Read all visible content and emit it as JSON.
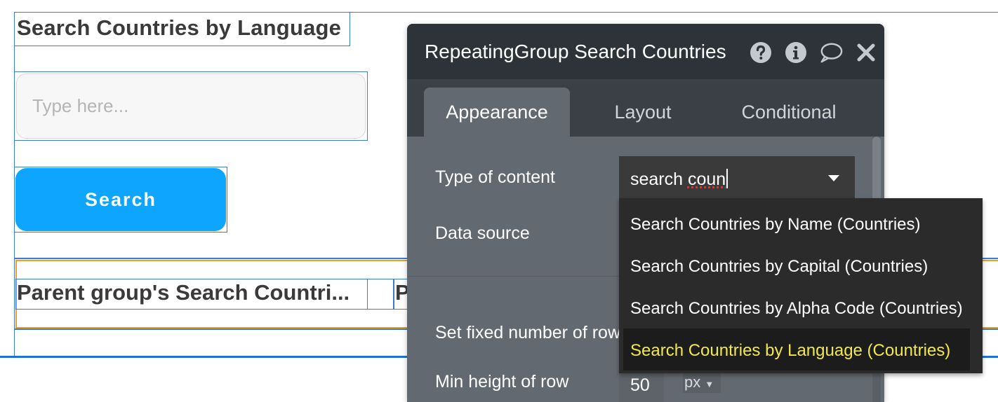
{
  "canvas": {
    "page_title": "Search Countries by Language",
    "input_placeholder": "Type here...",
    "search_button": "Search",
    "repeating_group": {
      "cell1_text": "Parent group's Search Countri...",
      "cell3_text": "P"
    }
  },
  "panel": {
    "title": "RepeatingGroup Search Countries",
    "icons": [
      "help-icon",
      "info-icon",
      "comment-icon",
      "close-icon"
    ],
    "tabs": [
      {
        "label": "Appearance",
        "active": true
      },
      {
        "label": "Layout",
        "active": false
      },
      {
        "label": "Conditional",
        "active": false
      }
    ],
    "properties": {
      "type_of_content_label": "Type of content",
      "type_of_content_value_prefix": "search ",
      "type_of_content_value_misspelled": "coun",
      "data_source_label": "Data source",
      "fixed_rows_label": "Set fixed number of rows",
      "min_height_label": "Min height of row",
      "min_height_value": "50",
      "min_height_unit": "px"
    }
  },
  "dropdown": {
    "items": [
      "Search Countries by Name (Countries)",
      "Search Countries by Capital (Countries)",
      "Search Countries by Alpha Code (Countries)",
      "Search Countries by Language (Countries)"
    ],
    "highlighted_index": 3,
    "highlight_color": "#f1e84a"
  },
  "colors": {
    "accent_button": "#0ea5ff",
    "selection_outline": "#3b7bd6",
    "repeating_group_outline": "#e6a02c",
    "panel_header": "#2d3338",
    "panel_body": "#626970"
  }
}
